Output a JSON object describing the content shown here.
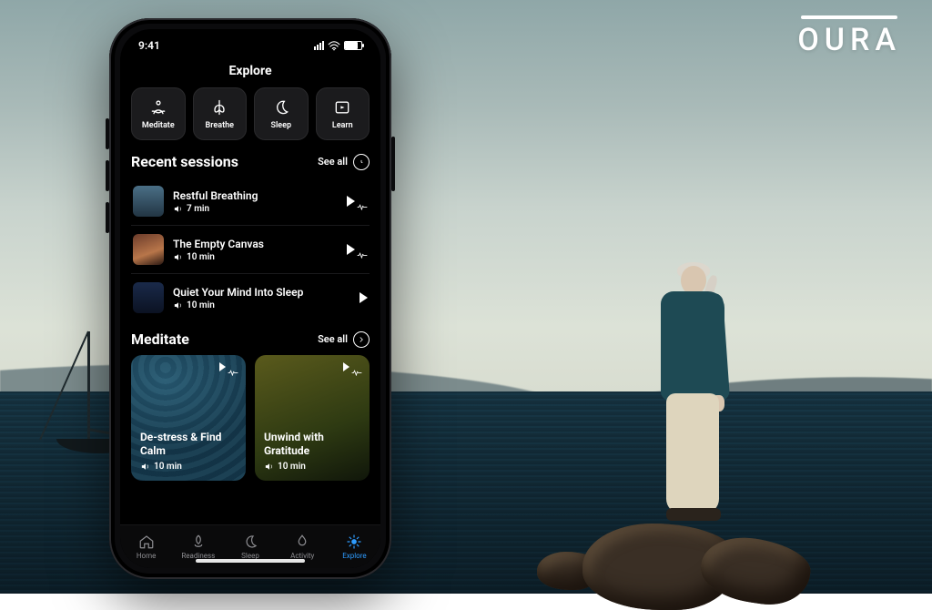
{
  "brand": "OURA",
  "statusbar": {
    "time": "9:41"
  },
  "page": {
    "title": "Explore"
  },
  "categories": [
    {
      "key": "meditate",
      "label": "Meditate"
    },
    {
      "key": "breathe",
      "label": "Breathe"
    },
    {
      "key": "sleep",
      "label": "Sleep"
    },
    {
      "key": "learn",
      "label": "Learn"
    }
  ],
  "recent": {
    "heading": "Recent sessions",
    "see_all": "See all",
    "items": [
      {
        "title": "Restful Breathing",
        "duration": "7 min",
        "thumb": "sky",
        "pulse": true
      },
      {
        "title": "The Empty Canvas",
        "duration": "10 min",
        "thumb": "desert",
        "pulse": true
      },
      {
        "title": "Quiet Your Mind Into Sleep",
        "duration": "10 min",
        "thumb": "night",
        "pulse": false
      }
    ]
  },
  "meditate": {
    "heading": "Meditate",
    "see_all": "See all",
    "cards": [
      {
        "title": "De-stress & Find Calm",
        "duration": "10 min",
        "art": "waves"
      },
      {
        "title": "Unwind with Gratitude",
        "duration": "10 min",
        "art": "grass"
      }
    ]
  },
  "tabs": [
    {
      "key": "home",
      "label": "Home"
    },
    {
      "key": "readiness",
      "label": "Readiness"
    },
    {
      "key": "sleep",
      "label": "Sleep"
    },
    {
      "key": "activity",
      "label": "Activity"
    },
    {
      "key": "explore",
      "label": "Explore",
      "active": true
    }
  ]
}
